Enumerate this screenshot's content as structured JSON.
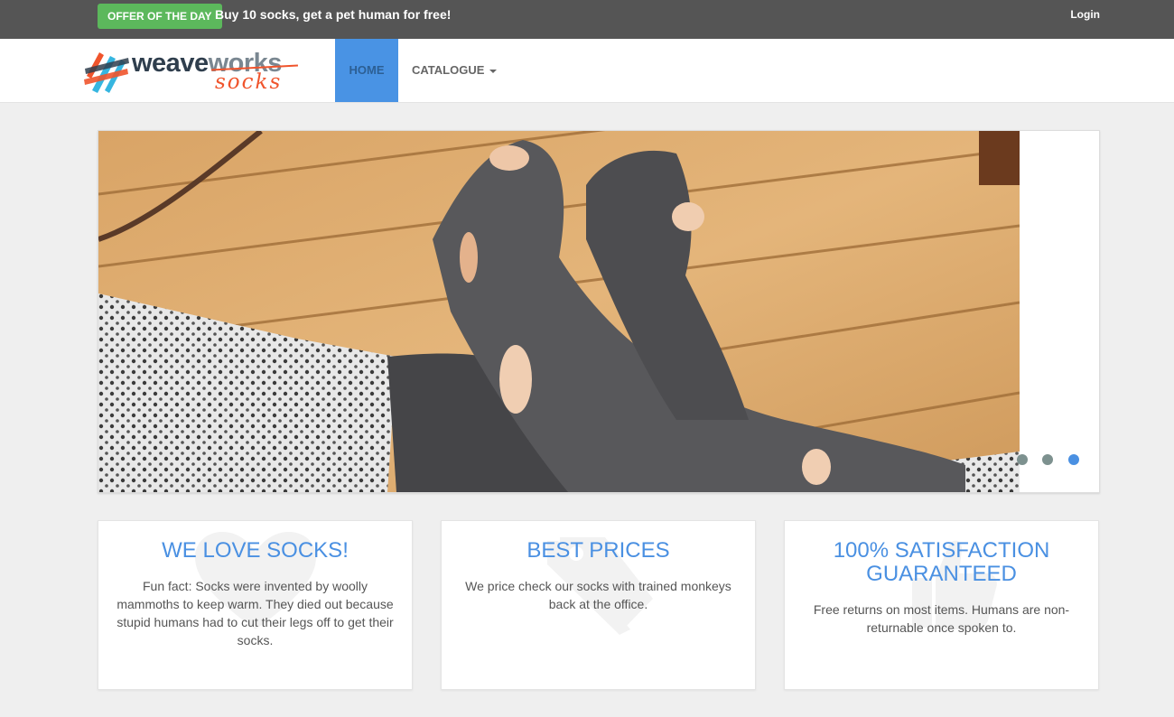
{
  "topbar": {
    "offer_badge": "OFFER OF THE DAY",
    "offer_text": "Buy 10 socks, get a pet human for free!",
    "login": "Login"
  },
  "logo": {
    "word_main": "weave",
    "word_accent": "works",
    "sub": "socks"
  },
  "nav": {
    "home": "HOME",
    "catalogue": "CATALOGUE"
  },
  "carousel": {
    "slide_count": 3,
    "active_index": 2
  },
  "features": [
    {
      "title": "WE LOVE SOCKS!",
      "text": "Fun fact: Socks were invented by woolly mammoths to keep warm. They died out because stupid humans had to cut their legs off to get their socks.",
      "icon": "heart-icon"
    },
    {
      "title": "BEST PRICES",
      "text": "We price check our socks with trained monkeys back at the office.",
      "icon": "tags-icon"
    },
    {
      "title": "100% SATISFACTION GUARANTEED",
      "text": "Free returns on most items. Humans are non-returnable once spoken to.",
      "icon": "thumbs-up-icon"
    }
  ],
  "colors": {
    "topbar_bg": "#555555",
    "offer_green": "#5cb85c",
    "accent_blue": "#4a90e2",
    "logo_orange": "#f0542c"
  }
}
